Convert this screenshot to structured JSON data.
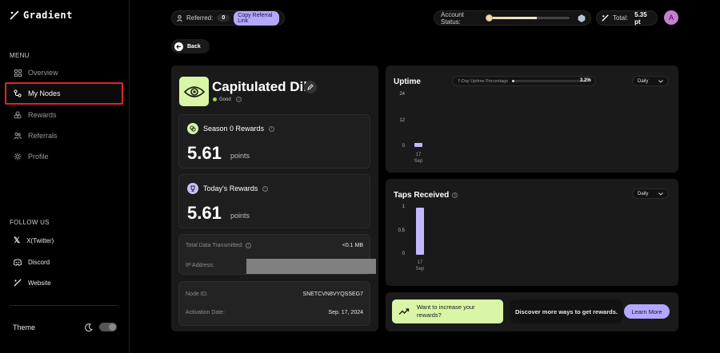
{
  "sidebar": {
    "logo": "Gradient",
    "menu_label": "MENU",
    "items": [
      {
        "label": "Overview",
        "icon": "grid-icon"
      },
      {
        "label": "My Nodes",
        "icon": "link-icon"
      },
      {
        "label": "Rewards",
        "icon": "rewards-icon"
      },
      {
        "label": "Referrals",
        "icon": "referrals-icon"
      },
      {
        "label": "Profile",
        "icon": "settings-icon"
      }
    ],
    "follow_label": "FOLLOW US",
    "follow": [
      {
        "label": "X(Twitter)",
        "icon": "x-icon"
      },
      {
        "label": "Discord",
        "icon": "discord-icon"
      },
      {
        "label": "Website",
        "icon": "website-icon"
      }
    ],
    "theme_label": "Theme"
  },
  "topbar": {
    "referred_label": "Referred:",
    "referred_count": "0",
    "copy_label": "Copy Referral Link",
    "account_status_label": "Account Status:",
    "total_label": "Total:",
    "total_value": "5.35 pt",
    "avatar_letter": "A"
  },
  "back_label": "Back",
  "node": {
    "name": "Capitulated Dill",
    "status": "Good",
    "season_label": "Season 0 Rewards",
    "season_value": "5.61",
    "today_label": "Today's Rewards",
    "today_value": "5.61",
    "points_label": "points",
    "data_label": "Total Data Transmitted:",
    "data_value": "<0.1 MB",
    "ip_label": "IP Address:",
    "node_id_label": "Node ID:",
    "node_id_value": "SNETCVN8VYQSSEG7",
    "activation_label": "Activation Date:",
    "activation_value": "Sep. 17, 2024"
  },
  "uptime": {
    "title": "Uptime",
    "pct_label": "7-Day Uptime Percentage",
    "pct_value": "3.2%",
    "pct_fraction": 0.032,
    "dropdown": "Daily"
  },
  "taps": {
    "title": "Taps Received",
    "dropdown": "Daily"
  },
  "promo": {
    "line1": "Want to increase your",
    "line2": "rewards?",
    "middle": "Discover more ways to get rewards.",
    "button": "Learn More"
  },
  "chart_data": [
    {
      "type": "bar",
      "title": "Uptime",
      "categories": [
        "17\nSep"
      ],
      "values": [
        2
      ],
      "yticks": [
        "24",
        "12",
        "0"
      ],
      "ylim": [
        0,
        24
      ],
      "xlabel": "",
      "ylabel": ""
    },
    {
      "type": "bar",
      "title": "Taps Received",
      "categories": [
        "17\nSep"
      ],
      "values": [
        1
      ],
      "yticks": [
        "1",
        "0.5",
        "0"
      ],
      "ylim": [
        0,
        1
      ],
      "xlabel": "",
      "ylabel": ""
    }
  ]
}
